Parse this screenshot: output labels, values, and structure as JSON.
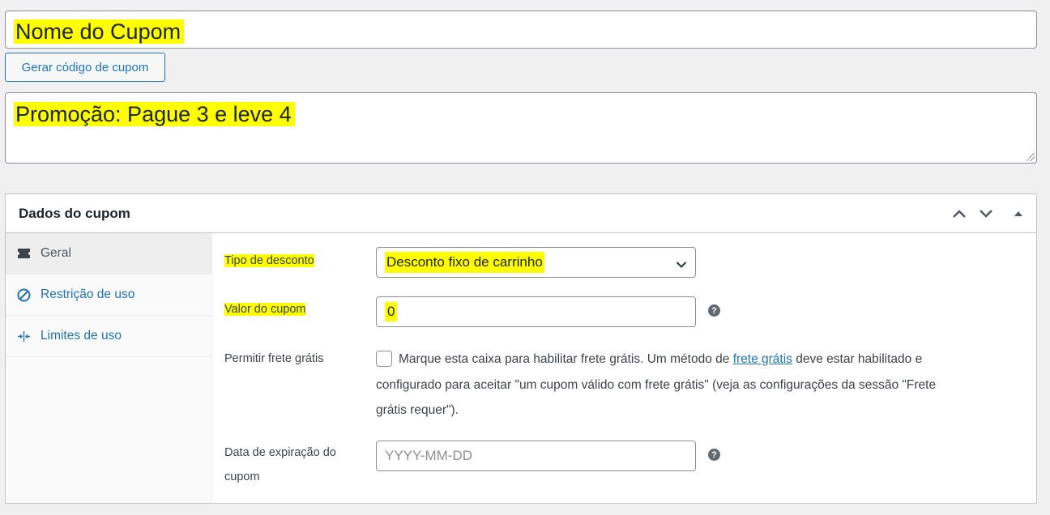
{
  "coupon": {
    "title": "Nome do Cupom",
    "generate_button": "Gerar código de cupom",
    "description": "Promoção: Pague 3 e leve 4"
  },
  "metabox": {
    "title": "Dados do cupom",
    "tabs": [
      {
        "label": "Geral",
        "icon": "ticket-icon"
      },
      {
        "label": "Restrição de uso",
        "icon": "block-icon"
      },
      {
        "label": "Limites de uso",
        "icon": "limits-icon"
      }
    ],
    "fields": {
      "discount_type_label": "Tipo de desconto",
      "discount_type_value": "Desconto fixo de carrinho",
      "amount_label": "Valor do cupom",
      "amount_value": "0",
      "free_shipping_label": "Permitir frete grátis",
      "free_shipping_text_before": "Marque esta caixa para habilitar frete grátis. Um método de ",
      "free_shipping_link": "frete grátis",
      "free_shipping_text_after": " deve estar habilitado e configurado para aceitar \"um cupom válido com frete grátis\" (veja as configurações da sessão \"Frete grátis requer\").",
      "expiry_label": "Data de expiração do cupom",
      "expiry_placeholder": "YYYY-MM-DD"
    },
    "help_glyph": "?"
  },
  "colors": {
    "highlight": "#ffff00",
    "link": "#2271b1",
    "border": "#8c8f94"
  }
}
